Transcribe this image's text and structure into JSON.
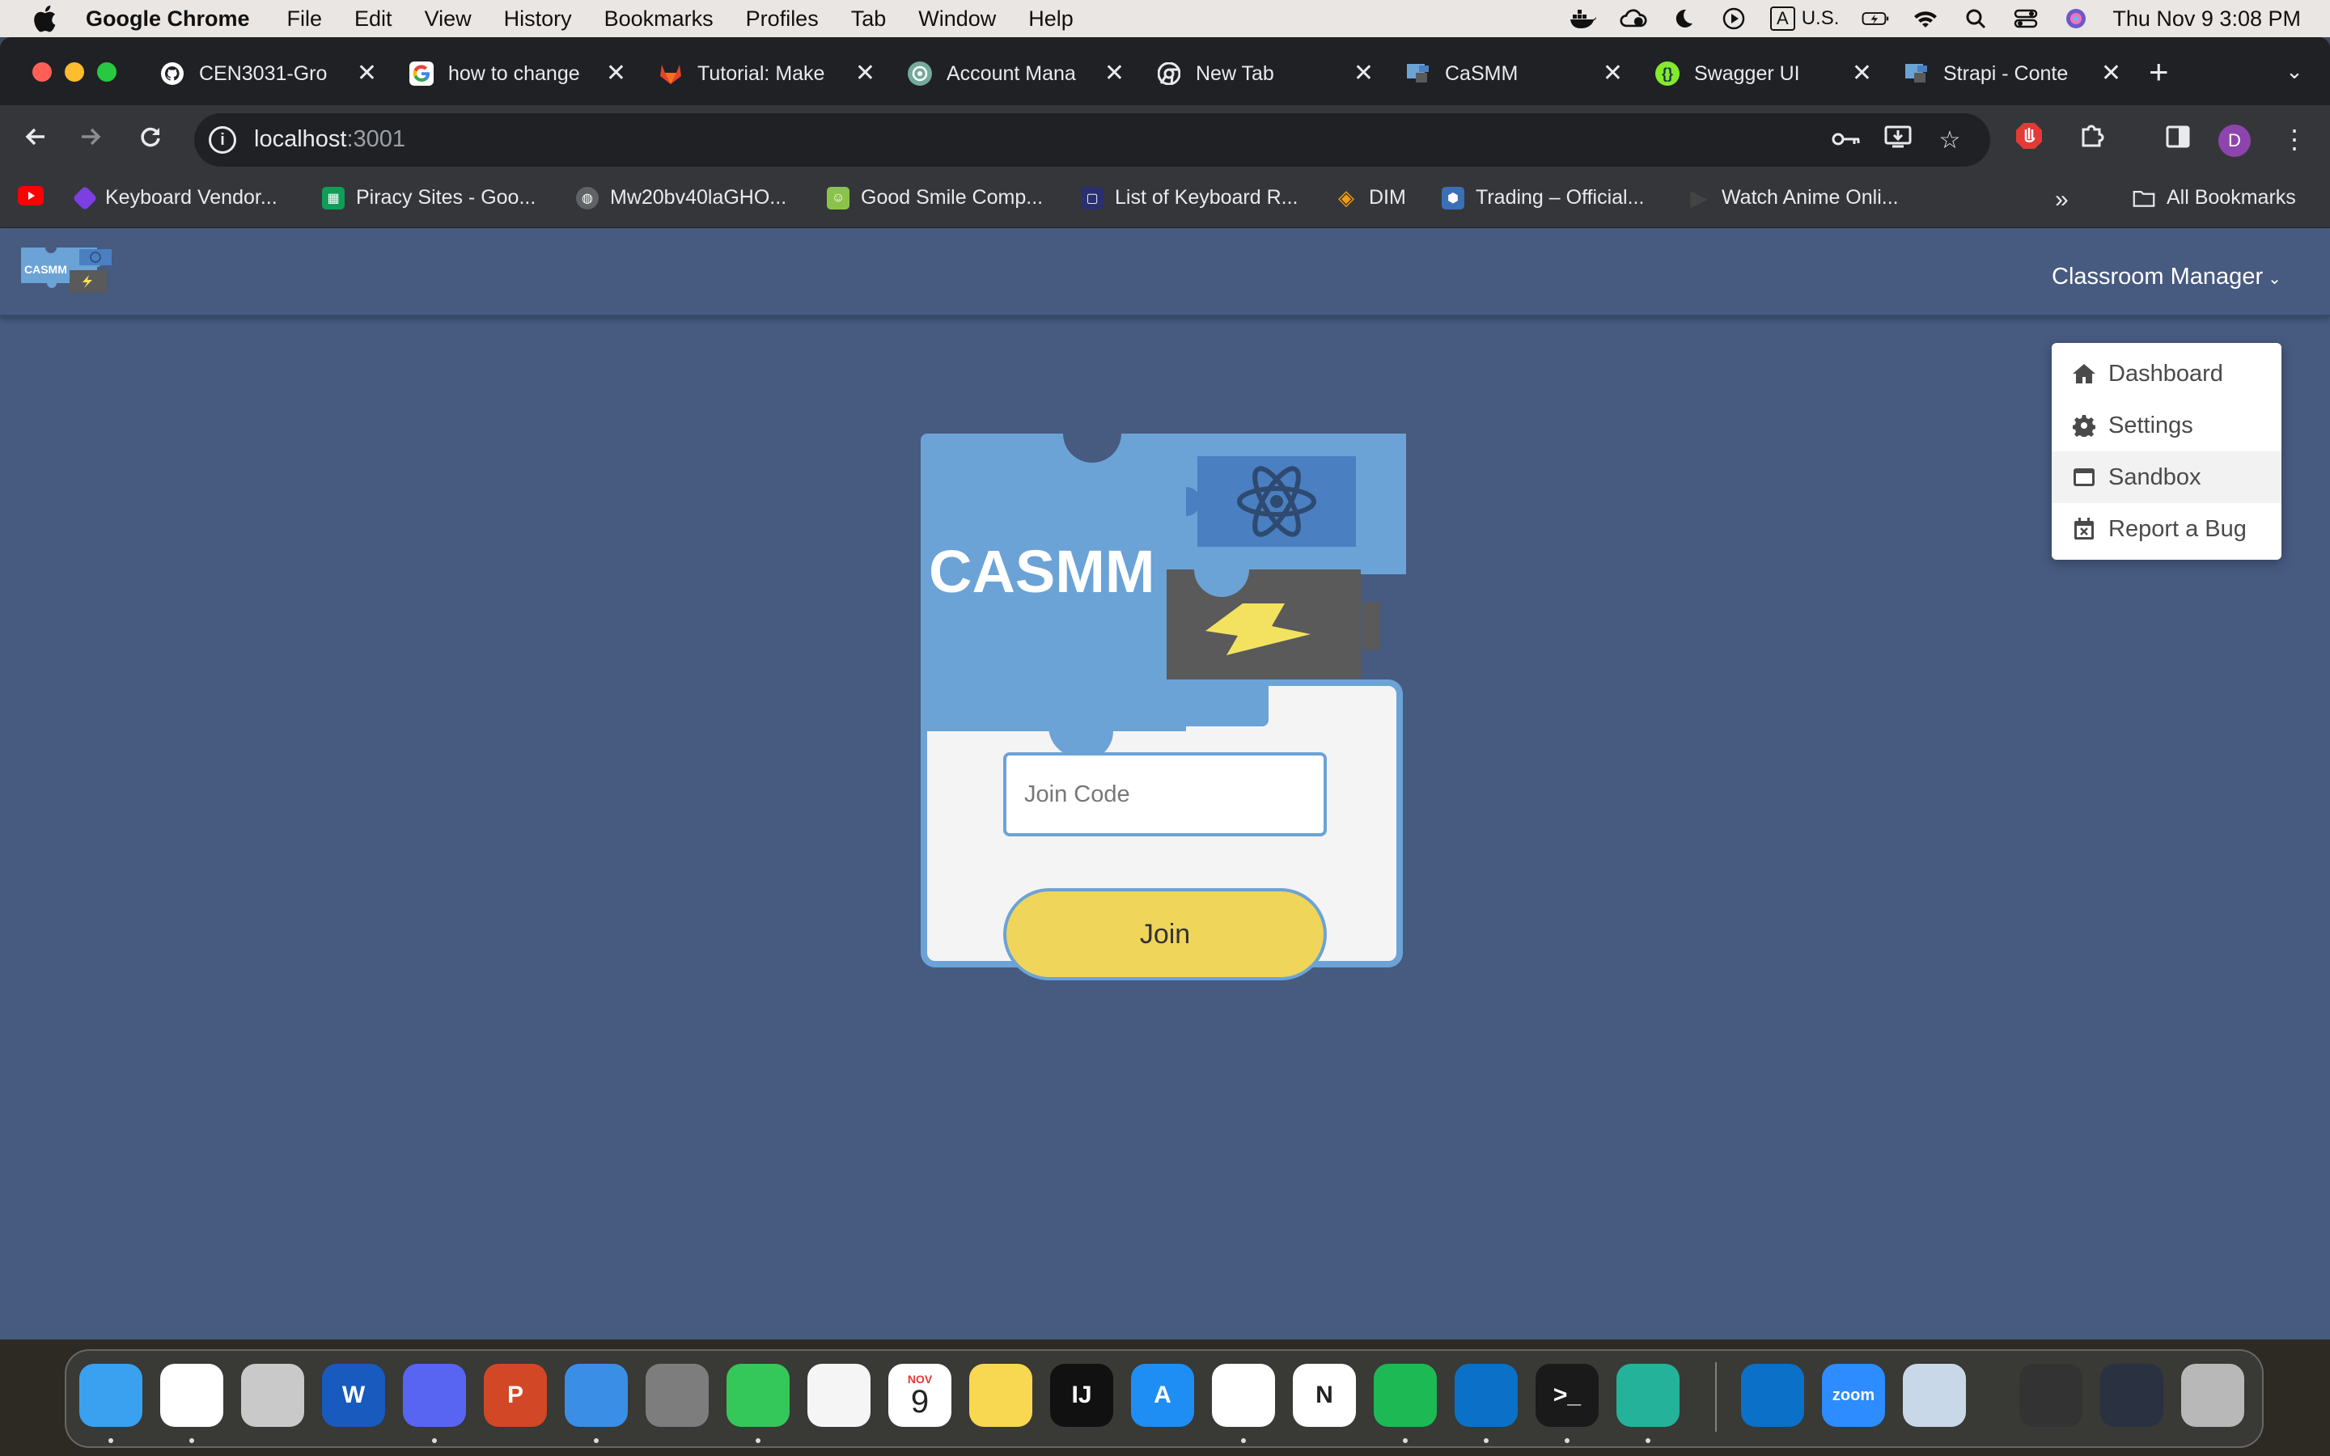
{
  "menubar": {
    "app_name": "Google Chrome",
    "items": [
      "File",
      "Edit",
      "View",
      "History",
      "Bookmarks",
      "Profiles",
      "Tab",
      "Window",
      "Help"
    ],
    "input_source": "U.S.",
    "input_letter": "A",
    "clock": "Thu Nov 9  3:08 PM"
  },
  "tabs": [
    {
      "title": "CEN3031-Gro",
      "icon": "github-icon",
      "color": "#ffffff"
    },
    {
      "title": "how to change",
      "icon": "google-icon",
      "color": "#ffffff"
    },
    {
      "title": "Tutorial: Make",
      "icon": "gitlab-icon",
      "color": "#e24329"
    },
    {
      "title": "Account Mana",
      "icon": "openai-icon",
      "color": "#74aa9c"
    },
    {
      "title": "New Tab",
      "icon": "chrome-icon",
      "color": "#ffffff"
    },
    {
      "title": "CaSMM",
      "icon": "casmm-icon",
      "color": "#6ba3d6"
    },
    {
      "title": "Swagger UI",
      "icon": "swagger-icon",
      "color": "#85ea2d"
    },
    {
      "title": "Strapi - Conte",
      "icon": "casmm-icon",
      "color": "#6ba3d6"
    }
  ],
  "omnibox": {
    "host": "localhost",
    "port": ":3001"
  },
  "bookmarks": [
    {
      "label": "Keyboard Vendor...",
      "icon": "bookmark-gem-icon",
      "color": "#7b3fe4"
    },
    {
      "label": "Piracy Sites - Goo...",
      "icon": "sheets-icon",
      "color": "#0f9d58"
    },
    {
      "label": "Mw20bv40laGHO...",
      "icon": "globe-icon",
      "color": "#5f6368"
    },
    {
      "label": "Good Smile Comp...",
      "icon": "goodsmile-icon",
      "color": "#8bc34a"
    },
    {
      "label": "List of Keyboard R...",
      "icon": "chat-bubble-icon",
      "color": "#2a2f6e"
    },
    {
      "label": "DIM",
      "icon": "dim-icon",
      "color": "#f39c12"
    },
    {
      "label": "Trading – Official...",
      "icon": "cube-icon",
      "color": "#3b6fb6"
    },
    {
      "label": "Watch Anime Onli...",
      "icon": "play-icon",
      "color": "#444444"
    }
  ],
  "bookmarks_more": "»",
  "all_bookmarks": "All Bookmarks",
  "app": {
    "manager_label": "Classroom Manager",
    "dropdown": [
      {
        "label": "Dashboard",
        "icon": "home-icon"
      },
      {
        "label": "Settings",
        "icon": "gear-icon"
      },
      {
        "label": "Sandbox",
        "icon": "window-icon"
      },
      {
        "label": "Report a Bug",
        "icon": "calendar-x-icon"
      }
    ],
    "logo_text": "CASMM",
    "join_placeholder": "Join Code",
    "join_value": "",
    "join_button": "Join"
  },
  "dock": [
    {
      "name": "finder",
      "label": "",
      "color": "#3aa0f0"
    },
    {
      "name": "chrome",
      "label": "",
      "color": "#ffffff"
    },
    {
      "name": "launchpad",
      "label": "",
      "color": "#c9c9c9"
    },
    {
      "name": "word",
      "label": "W",
      "color": "#185abd"
    },
    {
      "name": "discord",
      "label": "",
      "color": "#5865f2"
    },
    {
      "name": "powerpoint",
      "label": "P",
      "color": "#d24726"
    },
    {
      "name": "mail",
      "label": "",
      "color": "#3a8ee6"
    },
    {
      "name": "system-settings",
      "label": "",
      "color": "#7d7d7d"
    },
    {
      "name": "messages",
      "label": "",
      "color": "#34c759"
    },
    {
      "name": "photos",
      "label": "",
      "color": "#f5f5f5"
    },
    {
      "name": "calendar",
      "label": "9",
      "month": "NOV",
      "color": "#ffffff"
    },
    {
      "name": "notes",
      "label": "",
      "color": "#f7d850"
    },
    {
      "name": "intellij",
      "label": "IJ",
      "color": "#111111"
    },
    {
      "name": "app-store",
      "label": "A",
      "color": "#1e8ef5"
    },
    {
      "name": "slack",
      "label": "",
      "color": "#ffffff"
    },
    {
      "name": "notion",
      "label": "N",
      "color": "#ffffff"
    },
    {
      "name": "spotify",
      "label": "",
      "color": "#1db954"
    },
    {
      "name": "vscode",
      "label": "",
      "color": "#0a70c8"
    },
    {
      "name": "terminal",
      "label": ">_",
      "color": "#1a1a1a"
    },
    {
      "name": "vscode-insiders",
      "label": "",
      "color": "#24b29a"
    },
    {
      "name": "vscode-2",
      "label": "",
      "color": "#0a70c8"
    },
    {
      "name": "zoom",
      "label": "zoom",
      "color": "#2d8cff"
    },
    {
      "name": "preview",
      "label": "",
      "color": "#c9d8e8"
    },
    {
      "name": "doc-stack",
      "label": "",
      "color": "#333333"
    },
    {
      "name": "screenshot-stack",
      "label": "",
      "color": "#2a3140"
    },
    {
      "name": "trash",
      "label": "",
      "color": "#b8b8b8"
    }
  ],
  "colors": {
    "page_bg": "#475a80",
    "logo_blue": "#6ba3d6",
    "logo_dark_blue": "#4a7fc1",
    "battery_gray": "#5a5a5a",
    "bolt_yellow": "#f3e260",
    "card_white": "#f4f4f4",
    "join_yellow": "#f0d55b"
  }
}
